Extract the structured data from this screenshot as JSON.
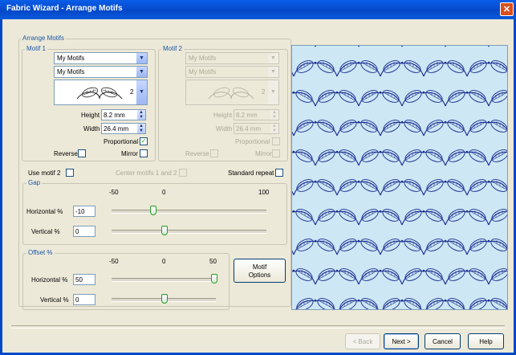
{
  "window": {
    "title": "Fabric Wizard - Arrange Motifs",
    "close_glyph": "✕"
  },
  "arrange": {
    "label": "Arrange Motifs",
    "motif1": {
      "label": "Motif 1",
      "combo1": "My Motifs",
      "combo2": "My Motifs",
      "motif_number": "2",
      "height_label": "Height",
      "height_value": "8.2 mm",
      "width_label": "Width",
      "width_value": "26.4 mm",
      "proportional_label": "Proportional",
      "proportional_checked": true,
      "reverse_label": "Reverse",
      "mirror_label": "Mirror"
    },
    "motif2": {
      "label": "Motif 2",
      "combo1": "My Motifs",
      "combo2": "My Motifs",
      "motif_number": "2",
      "height_label": "Height",
      "height_value": "8.2 mm",
      "width_label": "Width",
      "width_value": "26.4 mm",
      "proportional_label": "Proportional",
      "reverse_label": "Reverse",
      "mirror_label": "Mirror"
    },
    "use_motif2_label": "Use motif 2",
    "center_motifs_label": "Center motifs 1 and 2",
    "standard_repeat_label": "Standard repeat"
  },
  "gap": {
    "label": "Gap",
    "scale": [
      "-50",
      "0",
      "100"
    ],
    "horizontal_label": "Horizontal %",
    "horizontal_value": "-10",
    "vertical_label": "Vertical %",
    "vertical_value": "0"
  },
  "offset": {
    "label": "Offset %",
    "scale": [
      "-50",
      "0",
      "50"
    ],
    "horizontal_label": "Horizontal %",
    "horizontal_value": "50",
    "vertical_label": "Vertical %",
    "vertical_value": "0"
  },
  "motif_options_label": [
    "Motif",
    "Options"
  ],
  "buttons": {
    "back": "< Back",
    "next": "Next >",
    "cancel": "Cancel",
    "help": "Help"
  },
  "colors": {
    "accent": "#1a55a8",
    "preview_bg": "#cde7f5",
    "motif_stroke": "#1b2d8f"
  }
}
